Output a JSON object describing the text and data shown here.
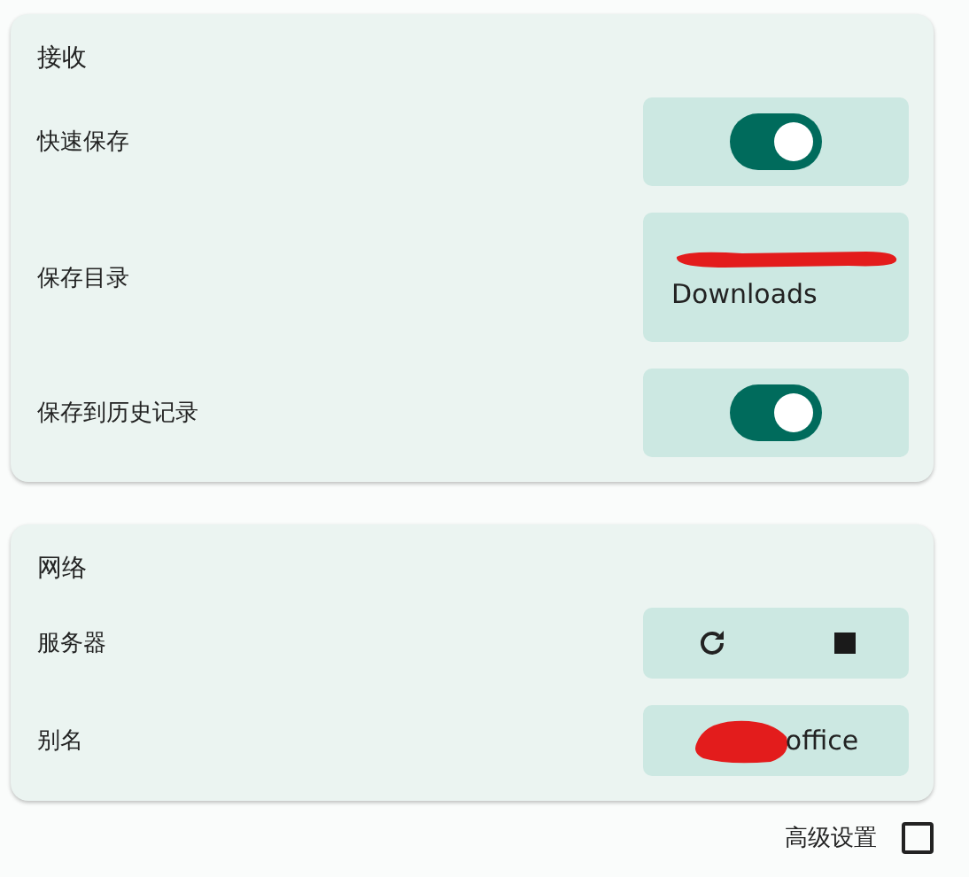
{
  "sections": [
    {
      "title": "接收",
      "rows": [
        {
          "kind": "toggle",
          "label": "快速保存",
          "on": true
        },
        {
          "kind": "path",
          "label": "保存目录",
          "value": "Downloads",
          "redacted": true
        },
        {
          "kind": "toggle",
          "label": "保存到历史记录",
          "on": true
        }
      ]
    },
    {
      "title": "网络",
      "rows": [
        {
          "kind": "actions",
          "label": "服务器"
        },
        {
          "kind": "text",
          "label": "别名",
          "value": "office",
          "redacted": true
        }
      ]
    }
  ],
  "advanced": {
    "label": "高级设置",
    "checked": false
  }
}
